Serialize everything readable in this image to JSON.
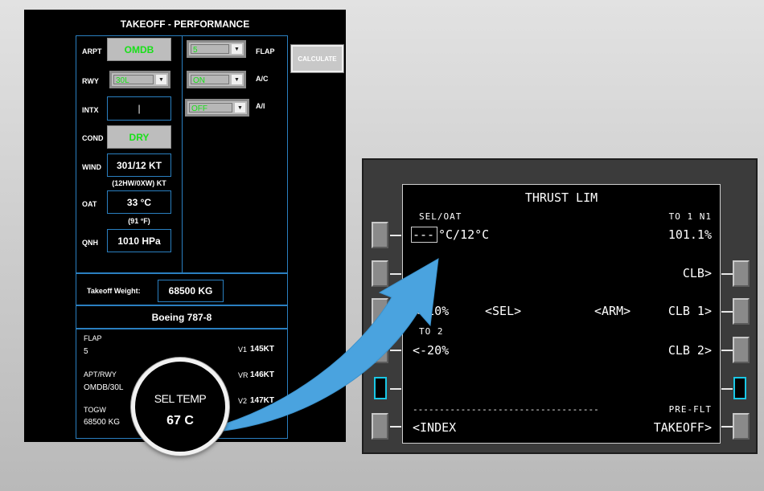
{
  "perf": {
    "title": "TAKEOFF - PERFORMANCE",
    "arpt_label": "ARPT",
    "arpt": "OMDB",
    "rwy_label": "RWY",
    "rwy": "30L",
    "intx_label": "INTX",
    "intx": "|",
    "cond_label": "COND",
    "cond": "DRY",
    "wind_label": "WIND",
    "wind": "301/12 KT",
    "wind_sub": "(12HW/0XW) KT",
    "oat_label": "OAT",
    "oat": "33 °C",
    "oat_sub": "(91 °F)",
    "qnh_label": "QNH",
    "qnh": "1010 HPa",
    "flap_label": "FLAP",
    "flap": "5",
    "ac_label": "A/C",
    "ac": "ON",
    "ai_label": "A/I",
    "ai": "OFF",
    "calc_label": "CALCULATE",
    "tow_label": "Takeoff Weight:",
    "tow": "68500 KG",
    "aircraft": "Boeing 787-8",
    "res": {
      "flap_label": "FLAP",
      "flap": "5",
      "aptrwy_label": "APT/RWY",
      "aptrwy": "OMDB/30L",
      "togw_label": "TOGW",
      "togw": "68500 KG",
      "v1_label": "V1",
      "v1": "145KT",
      "vr_label": "VR",
      "vr": "146KT",
      "v2_label": "V2",
      "v2": "147KT"
    }
  },
  "magnifier": {
    "label": "SEL TEMP",
    "value": "67 C"
  },
  "cdu": {
    "title": "THRUST LIM",
    "sel_oat_label": "SEL/OAT",
    "sel_oat_entry": "---",
    "sel_oat_value": "°C/12°C",
    "to1n1_label": "TO 1 N1",
    "to1n1": "101.1%",
    "clb": "CLB>",
    "to1_minus10": "<-10%",
    "sel": "<SEL>",
    "arm": "<ARM>",
    "clb1": "CLB 1>",
    "to2_label": "TO 2",
    "to2_minus20": "<-20%",
    "clb2": "CLB 2>",
    "divider": "-----------------------------------",
    "preflt": "PRE-FLT",
    "index": "<INDEX",
    "takeoff": "TAKEOFF>"
  },
  "colors": {
    "accent_blue": "#4aa3df",
    "green_value": "#19e019",
    "panel_border": "#2a7fc0"
  }
}
